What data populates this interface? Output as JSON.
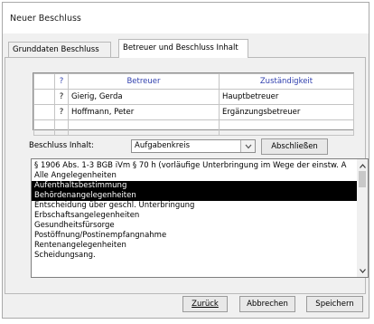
{
  "window": {
    "title": "Neuer Beschluss"
  },
  "tabs": [
    {
      "label": "Grunddaten Beschluss"
    },
    {
      "label": "Betreuer und Beschluss Inhalt"
    }
  ],
  "grid": {
    "headers": {
      "marker": "?",
      "betreuer": "Betreuer",
      "zustaendigkeit": "Zuständigkeit"
    },
    "rows": [
      {
        "marker": "?",
        "betreuer": "Gierig, Gerda",
        "zustaendigkeit": "Hauptbetreuer"
      },
      {
        "marker": "?",
        "betreuer": "Hoffmann, Peter",
        "zustaendigkeit": "Ergänzungsbetreuer"
      }
    ]
  },
  "beschluss": {
    "label": "Beschluss Inhalt:",
    "combo_value": "Aufgabenkreis",
    "close_button": "Abschließen"
  },
  "list": {
    "items": [
      {
        "text": "§ 1906 Abs. 1-3 BGB iVm § 70 h (vorläufige Unterbringung im Wege der einstw. A",
        "selected": false
      },
      {
        "text": "Alle Angelegenheiten",
        "selected": false
      },
      {
        "text": "Aufenthaltsbestimmung",
        "selected": true
      },
      {
        "text": "Behördenangelegenheiten",
        "selected": true
      },
      {
        "text": "Entscheidung über geschl. Unterbringung",
        "selected": false
      },
      {
        "text": "Erbschaftsangelegenheiten",
        "selected": false
      },
      {
        "text": "Gesundheitsfürsorge",
        "selected": false
      },
      {
        "text": "Postöffnung/Postinempfangnahme",
        "selected": false
      },
      {
        "text": "Rentenangelegenheiten",
        "selected": false
      },
      {
        "text": "Scheidungsang.",
        "selected": false
      }
    ]
  },
  "footer": {
    "back": "Zurück",
    "cancel": "Abbrechen",
    "save": "Speichern"
  },
  "colors": {
    "header_text": "#2f3fae",
    "selection_bg": "#000000"
  }
}
